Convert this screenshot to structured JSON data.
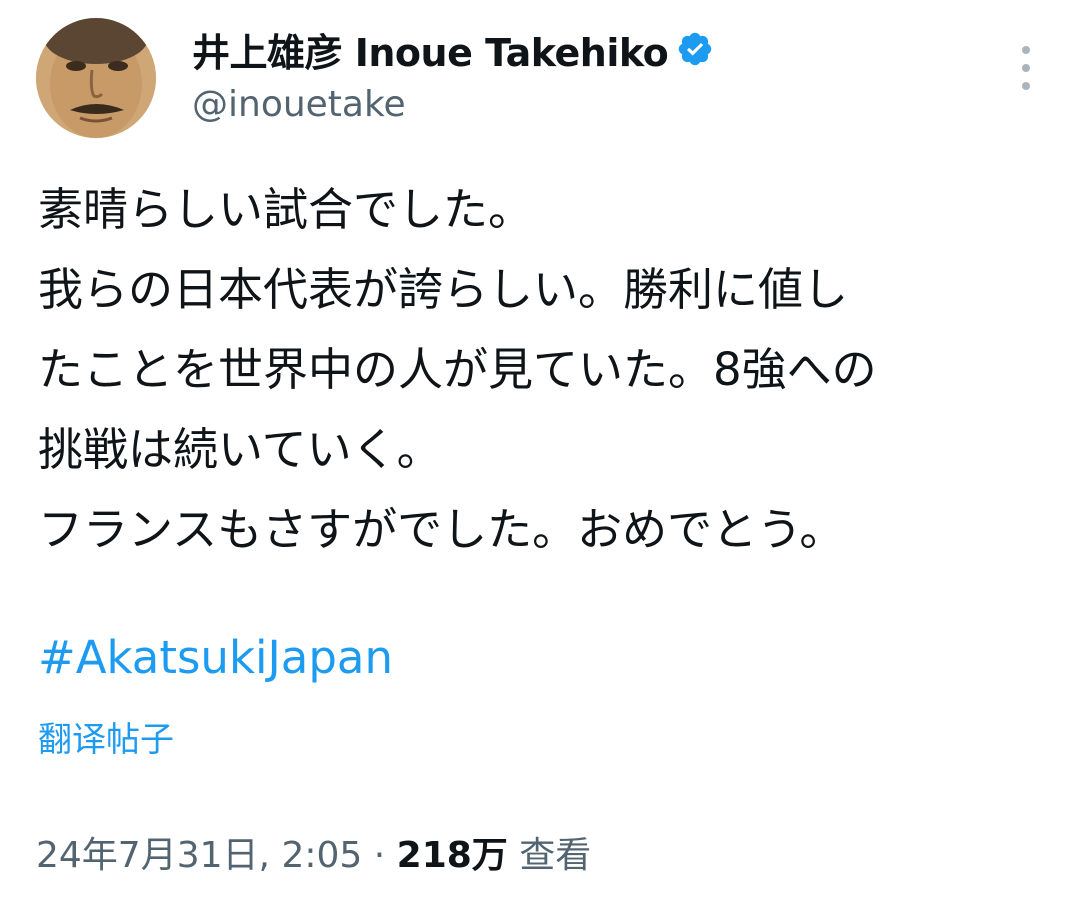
{
  "author": {
    "display_name": "井上雄彦 Inoue Takehiko",
    "handle": "@inouetake",
    "verified": true
  },
  "icons": {
    "avatar": "avatar",
    "verified": "verified-badge-icon",
    "more": "more-vertical-icon"
  },
  "tweet": {
    "lines": [
      "素晴らしい試合でした。",
      "我らの日本代表が誇らしい。勝利に値し",
      "たことを世界中の人が見ていた。8強への",
      "挑戦は続いていく。",
      "フランスもさすがでした。おめでとう。"
    ],
    "hashtag": "#AkatsukiJapan",
    "translate_label": "翻译帖子"
  },
  "meta": {
    "date": "24年7月31日",
    "separator_comma": ",",
    "time": "2:05",
    "dot": "·",
    "views_count": "218万",
    "views_label": "查看"
  },
  "colors": {
    "text": "#0f1419",
    "secondary": "#536471",
    "link": "#1d9bf0",
    "verified": "#1d9bf0"
  }
}
